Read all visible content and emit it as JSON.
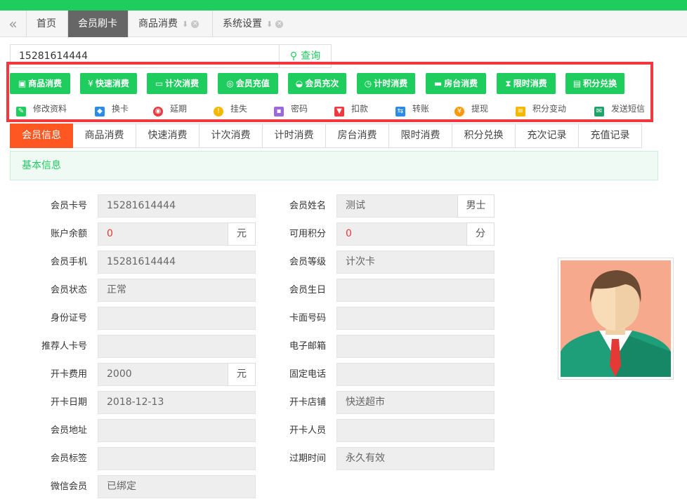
{
  "tabs": [
    {
      "label": "首页"
    },
    {
      "label": "会员刷卡"
    },
    {
      "label": "商品消费"
    },
    {
      "label": "系统设置"
    }
  ],
  "icons": {
    "back": "double-chevron-left-icon",
    "pin": "pin-icon",
    "close": "close-icon",
    "search": "magnifier-icon"
  },
  "search": {
    "value": "15281614444",
    "button_label": "查询"
  },
  "primary_actions": [
    {
      "label": "商品消费",
      "icon": "bag-icon"
    },
    {
      "label": "快速消费",
      "icon": "yen-icon"
    },
    {
      "label": "计次消费",
      "icon": "card-icon"
    },
    {
      "label": "会员充值",
      "icon": "coin-icon"
    },
    {
      "label": "会员充次",
      "icon": "inbox-icon"
    },
    {
      "label": "计时消费",
      "icon": "clock-icon"
    },
    {
      "label": "房台消费",
      "icon": "cup-icon"
    },
    {
      "label": "限时消费",
      "icon": "hourglass-icon"
    },
    {
      "label": "积分兑换",
      "icon": "database-icon"
    }
  ],
  "secondary_actions": [
    {
      "label": "修改资料",
      "icon": "edit-icon",
      "color": "#1fcc5e"
    },
    {
      "label": "换卡",
      "icon": "tag-icon",
      "color": "#2a8be8"
    },
    {
      "label": "延期",
      "icon": "target-icon",
      "color": "#f0383e"
    },
    {
      "label": "挂失",
      "icon": "warning-icon",
      "color": "#f5b800"
    },
    {
      "label": "密码",
      "icon": "lock-icon",
      "color": "#9c6ad6"
    },
    {
      "label": "扣款",
      "icon": "down-arrow-icon",
      "color": "#f0383e"
    },
    {
      "label": "转账",
      "icon": "transfer-icon",
      "color": "#2a8be8"
    },
    {
      "label": "提现",
      "icon": "yen-coin-icon",
      "color": "#ff9800"
    },
    {
      "label": "积分变动",
      "icon": "coins-icon",
      "color": "#f5b800"
    },
    {
      "label": "发送短信",
      "icon": "sms-icon",
      "color": "#1fa36a"
    }
  ],
  "subtabs": [
    "会员信息",
    "商品消费",
    "快速消费",
    "计次消费",
    "计时消费",
    "房台消费",
    "限时消费",
    "积分兑换",
    "充次记录",
    "充值记录"
  ],
  "section_title": "基本信息",
  "left_fields": [
    {
      "label": "会员卡号",
      "value": "15281614444"
    },
    {
      "label": "账户余额",
      "value": "0",
      "addon": "元"
    },
    {
      "label": "会员手机",
      "value": "15281614444"
    },
    {
      "label": "会员状态",
      "value": "正常"
    },
    {
      "label": "身份证号",
      "value": ""
    },
    {
      "label": "推荐人卡号",
      "value": ""
    },
    {
      "label": "开卡费用",
      "value": "2000",
      "addon": "元"
    },
    {
      "label": "开卡日期",
      "value": "2018-12-13"
    },
    {
      "label": "会员地址",
      "value": ""
    },
    {
      "label": "会员标签",
      "value": ""
    },
    {
      "label": "微信会员",
      "value": "已绑定"
    }
  ],
  "right_fields": [
    {
      "label": "会员姓名",
      "value": "测试",
      "addon": "男士"
    },
    {
      "label": "可用积分",
      "value": "0",
      "addon": "分"
    },
    {
      "label": "会员等级",
      "value": "计次卡"
    },
    {
      "label": "会员生日",
      "value": ""
    },
    {
      "label": "卡面号码",
      "value": ""
    },
    {
      "label": "电子邮箱",
      "value": ""
    },
    {
      "label": "固定电话",
      "value": ""
    },
    {
      "label": "开卡店铺",
      "value": "快送超市"
    },
    {
      "label": "开卡人员",
      "value": ""
    },
    {
      "label": "过期时间",
      "value": "永久有效"
    }
  ],
  "colors": {
    "brand_green": "#1fcc5e",
    "active_orange": "#ff5722",
    "highlight_red": "#f0383e",
    "value_red": "#e53935"
  }
}
